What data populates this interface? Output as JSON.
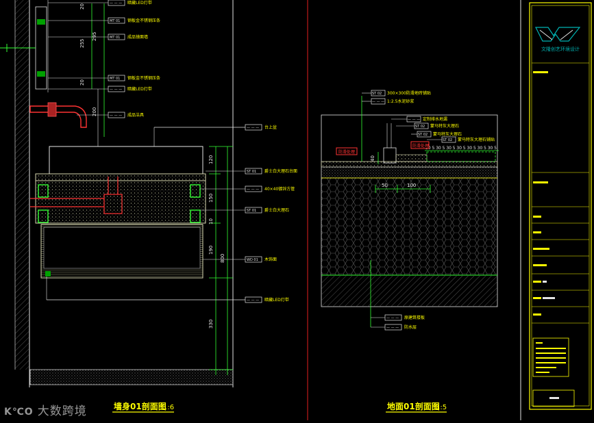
{
  "left": {
    "title": "墙身01剖面图",
    "scale": "1:6",
    "dims_top": [
      "20",
      "295",
      "255",
      "20",
      "200"
    ],
    "dims_right": [
      "120",
      "150",
      "10",
      "190",
      "800",
      "330"
    ],
    "labels": [
      {
        "code": "— — —",
        "text": "暗藏LED灯带"
      },
      {
        "code": "MT 01",
        "text": "钢板金不锈钢压条"
      },
      {
        "code": "MT 01",
        "text": "成品镜面墙"
      },
      {
        "code": "MT 01",
        "text": "钢板金不锈钢压条"
      },
      {
        "code": "— — —",
        "text": "暗藏LED灯带"
      },
      {
        "code": "— — —",
        "text": "成品洁具"
      },
      {
        "code": "— — —",
        "text": "台上盆"
      },
      {
        "code": "ST 01",
        "text": "爵士白大理石台面"
      },
      {
        "code": "— — —",
        "text": "40×40镀锌方管"
      },
      {
        "code": "ST 01",
        "text": "爵士白大理石"
      },
      {
        "code": "WD 01",
        "text": "木饰面"
      },
      {
        "code": "— — —",
        "text": "暗藏LED灯带"
      }
    ]
  },
  "right": {
    "title": "地面01剖面图",
    "scale": "1:5",
    "dims": [
      "40",
      "50",
      "100"
    ],
    "dim_string": "30 5 30 5 30 5 30 5 30 5 30 5 30 5",
    "red_tags": [
      "防滑处理",
      "防滑处理"
    ],
    "labels_top": [
      {
        "code": "ST 02",
        "text": "300×300防滑地砖铺贴"
      },
      {
        "code": "— — —",
        "text": "1:2.5水泥砂浆"
      },
      {
        "code": "— — —",
        "text": "定制排水地漏"
      },
      {
        "code": "ST 02",
        "text": "蒙马特灰大理石"
      },
      {
        "code": "ST 02",
        "text": "蒙马特灰大理石"
      },
      {
        "code": "ST 02",
        "text": "蒙马特灰大理石铺贴"
      }
    ],
    "labels_bottom": [
      {
        "code": "— — —",
        "text": "原建筑楼板"
      },
      {
        "code": "— — —",
        "text": "防水层"
      }
    ]
  },
  "titleblock": {
    "company": "文隆创艺环境设计"
  },
  "watermark": {
    "logo": "K℃O",
    "text": "大数跨境"
  },
  "colors": {
    "background": "#000000",
    "line_white": "#e6e6e6",
    "dim_green": "#33ff33",
    "frame_yellow": "#ffff00",
    "red": "#ff3333",
    "teal": "#00b3b3"
  }
}
